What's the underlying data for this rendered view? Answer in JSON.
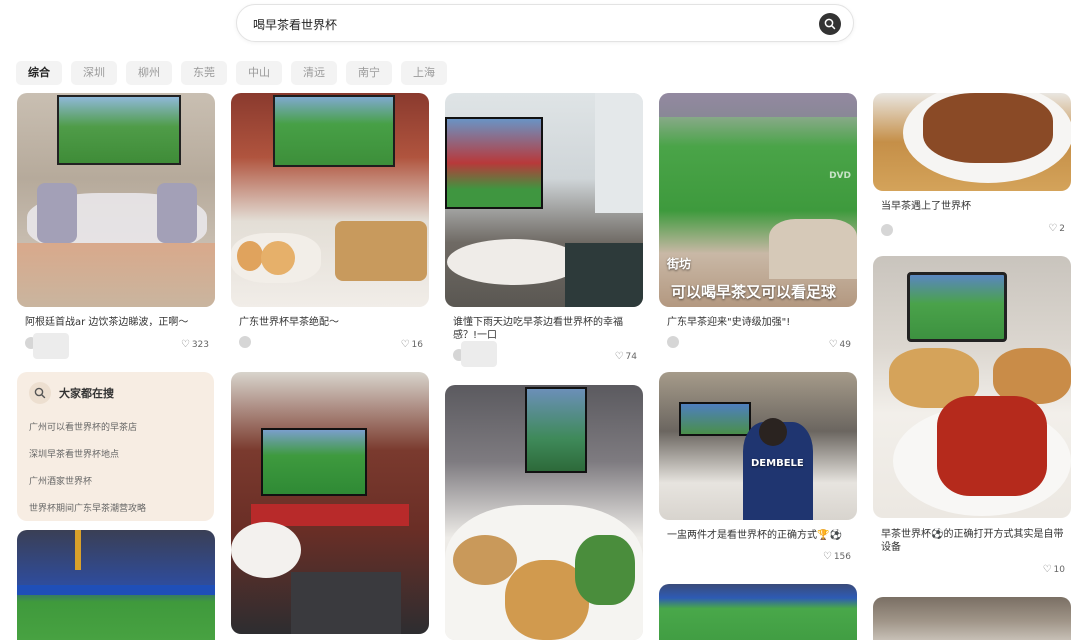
{
  "search": {
    "query": "喝早茶看世界杯"
  },
  "filters": [
    "综合",
    "深圳",
    "柳州",
    "东莞",
    "中山",
    "清远",
    "南宁",
    "上海"
  ],
  "cards": {
    "c1": {
      "caption": "阿根廷首战ar 边饮茶边睇波，正啊～",
      "likes": "323"
    },
    "c2": {
      "caption": "广东世界杯早茶绝配～",
      "likes": "16"
    },
    "c3": {
      "caption": "谁懂下雨天边吃早茶边看世界杯的幸福感？!一口",
      "likes": "74"
    },
    "c4": {
      "caption": "广东早茶迎来\"史诗级加强\"!",
      "likes": "49",
      "overlay_small": "街坊",
      "overlay_big": "可以喝早茶又可以看足球",
      "watermark": "DVD"
    },
    "c5": {
      "caption": "当早茶遇上了世界杯",
      "likes": "2"
    },
    "c6": {
      "caption": "早茶世界杯⚽的正确打开方式其实是自带设备",
      "likes": "10"
    },
    "c7": {
      "caption": "一盅两件才是看世界杯的正确方式🏆⚽",
      "likes": "156",
      "jersey": "DEMBELE"
    }
  },
  "suggest": {
    "title": "大家都在搜",
    "items": [
      "广州可以看世界杯的早茶店",
      "深圳早茶看世界杯地点",
      "广州酒家世界杯",
      "世界杯期间广东早茶潮营攻略"
    ]
  },
  "colors": {
    "pitch": "#3f9a3c",
    "suggest_bg": "#f7ede3",
    "chip_bg": "#f3f3f3"
  }
}
